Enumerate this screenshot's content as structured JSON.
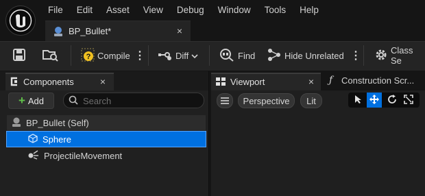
{
  "menu": [
    "File",
    "Edit",
    "Asset",
    "View",
    "Debug",
    "Window",
    "Tools",
    "Help"
  ],
  "asset_tab": {
    "label": "BP_Bullet*",
    "close": "×"
  },
  "toolbar": {
    "compile": "Compile",
    "diff": "Diff",
    "find": "Find",
    "hide_unrelated": "Hide Unrelated",
    "class_settings": "Class Se"
  },
  "components": {
    "tab_label": "Components",
    "close": "×",
    "add_label": "Add",
    "search_placeholder": "Search",
    "items": [
      {
        "label": "BP_Bullet (Self)"
      },
      {
        "label": "Sphere"
      },
      {
        "label": "ProjectileMovement"
      }
    ]
  },
  "viewport": {
    "tab_label": "Viewport",
    "close": "×",
    "construction_tab": "Construction Scr...",
    "construction_glyph": "ƒ",
    "perspective": "Perspective",
    "lit": "Lit"
  },
  "colors": {
    "accent": "#0070e0",
    "add_green": "#61c24a",
    "compile_warning": "#f0c020"
  }
}
